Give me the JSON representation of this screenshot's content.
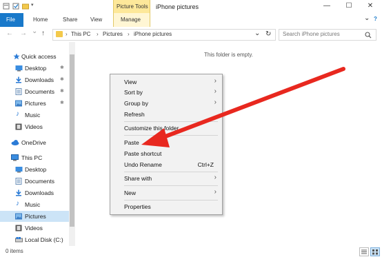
{
  "window": {
    "contextual_tab_header": "Picture Tools",
    "title": "iPhone pictures",
    "minimize": "—",
    "maximize": "☐",
    "close": "✕"
  },
  "ribbon": {
    "tabs": [
      "File",
      "Home",
      "Share",
      "View",
      "Manage"
    ],
    "expand": "⌄",
    "help": "?"
  },
  "address": {
    "back": "←",
    "forward": "→",
    "recent": "⌄",
    "up": "↑",
    "crumbs": [
      "This PC",
      "Pictures",
      "iPhone pictures"
    ],
    "separator": "›",
    "dropdown": "⌄",
    "refresh": "↻",
    "search_placeholder": "Search iPhone pictures",
    "search_icon": "search-icon"
  },
  "nav": {
    "items": [
      {
        "label": "Quick access",
        "icon": "star-icon",
        "pinned": false
      },
      {
        "label": "Desktop",
        "icon": "desktop-icon",
        "pinned": true
      },
      {
        "label": "Downloads",
        "icon": "downloads-icon",
        "pinned": true
      },
      {
        "label": "Documents",
        "icon": "documents-icon",
        "pinned": true
      },
      {
        "label": "Pictures",
        "icon": "pictures-icon",
        "pinned": true
      },
      {
        "label": "Music",
        "icon": "music-icon",
        "pinned": false
      },
      {
        "label": "Videos",
        "icon": "videos-icon",
        "pinned": false
      },
      {
        "label": "OneDrive",
        "icon": "cloud-icon",
        "pinned": false
      },
      {
        "label": "This PC",
        "icon": "computer-icon",
        "pinned": false
      },
      {
        "label": "Desktop",
        "icon": "desktop-icon",
        "pinned": false
      },
      {
        "label": "Documents",
        "icon": "documents-icon",
        "pinned": false
      },
      {
        "label": "Downloads",
        "icon": "downloads-icon",
        "pinned": false
      },
      {
        "label": "Music",
        "icon": "music-icon",
        "pinned": false
      },
      {
        "label": "Pictures",
        "icon": "pictures-icon",
        "pinned": false,
        "selected": true
      },
      {
        "label": "Videos",
        "icon": "videos-icon",
        "pinned": false
      },
      {
        "label": "Local Disk (C:)",
        "icon": "drive-icon",
        "pinned": false
      }
    ],
    "pin_glyph": "📌"
  },
  "content": {
    "empty_message": "This folder is empty."
  },
  "context_menu": {
    "items": [
      {
        "label": "View",
        "submenu": true
      },
      {
        "label": "Sort by",
        "submenu": true
      },
      {
        "label": "Group by",
        "submenu": true
      },
      {
        "label": "Refresh"
      },
      {
        "label": "Customize this folder..."
      },
      {
        "label": "Paste"
      },
      {
        "label": "Paste shortcut"
      },
      {
        "label": "Undo Rename",
        "shortcut": "Ctrl+Z"
      },
      {
        "label": "Share with",
        "submenu": true
      },
      {
        "label": "New",
        "submenu": true
      },
      {
        "label": "Properties"
      }
    ],
    "submenu_arrow": "›"
  },
  "status": {
    "item_count": "0 items"
  },
  "colors": {
    "accent": "#1979ca",
    "contextual_tab": "#fde89a",
    "selection": "#cce4f7",
    "annotation_arrow": "#e8281f"
  }
}
